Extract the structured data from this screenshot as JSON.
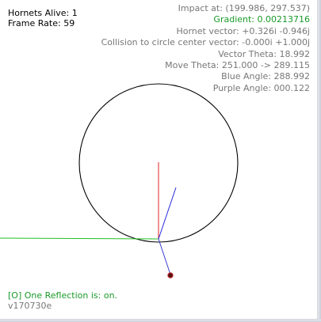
{
  "hud": {
    "hornets_alive": "Hornets Alive: 1",
    "frame_rate": "Frame Rate: 59"
  },
  "info": {
    "impact": "Impact at: (199.986, 297.537)",
    "gradient": "Gradient: 0.00213716",
    "hornet_vector": "Hornet vector: +0.326i -0.946j",
    "collision_vector": "Collision to circle center vector: -0.000i +1.000j",
    "vector_theta": "Vector Theta: 18.992",
    "move_theta": "Move Theta: 251.000 -> 289.115",
    "blue_angle": "Blue Angle: 288.992",
    "purple_angle": "Purple Angle: 000.122"
  },
  "footer": {
    "reflection_status": "[O] One Reflection is: on.",
    "version": "v170730e"
  },
  "colors": {
    "info_text": "#777777",
    "gradient_text": "#1a9a2a",
    "status_text": "#1a9a2a",
    "circle": "#000000",
    "red_line": "#e02020",
    "blue_line": "#2a2ad8",
    "green_line": "#20c020",
    "hornet": "#8b1a1a"
  },
  "icons": {
    "hornet": "dot-icon"
  }
}
